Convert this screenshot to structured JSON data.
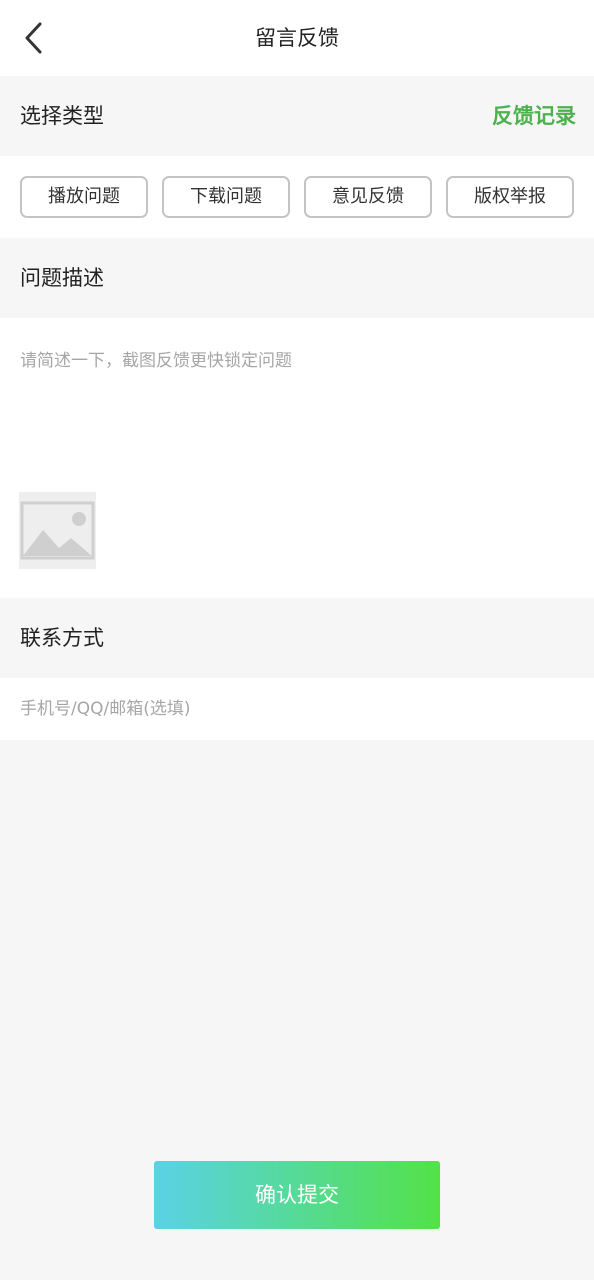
{
  "header": {
    "title": "留言反馈",
    "back_icon": "chevron-left-icon"
  },
  "type_section": {
    "title": "选择类型",
    "history_link": "反馈记录",
    "options": [
      "播放问题",
      "下载问题",
      "意见反馈",
      "版权举报"
    ]
  },
  "description_section": {
    "title": "问题描述",
    "placeholder": "请简述一下，截图反馈更快锁定问题",
    "value": "",
    "image_icon": "image-placeholder-icon"
  },
  "contact_section": {
    "title": "联系方式",
    "placeholder": "手机号/QQ/邮箱(选填)",
    "value": ""
  },
  "submit": {
    "label": "确认提交"
  },
  "colors": {
    "accent_green": "#4db24d",
    "gradient_start": "#5ad2e6",
    "gradient_end": "#52e247",
    "background": "#f6f6f6"
  }
}
